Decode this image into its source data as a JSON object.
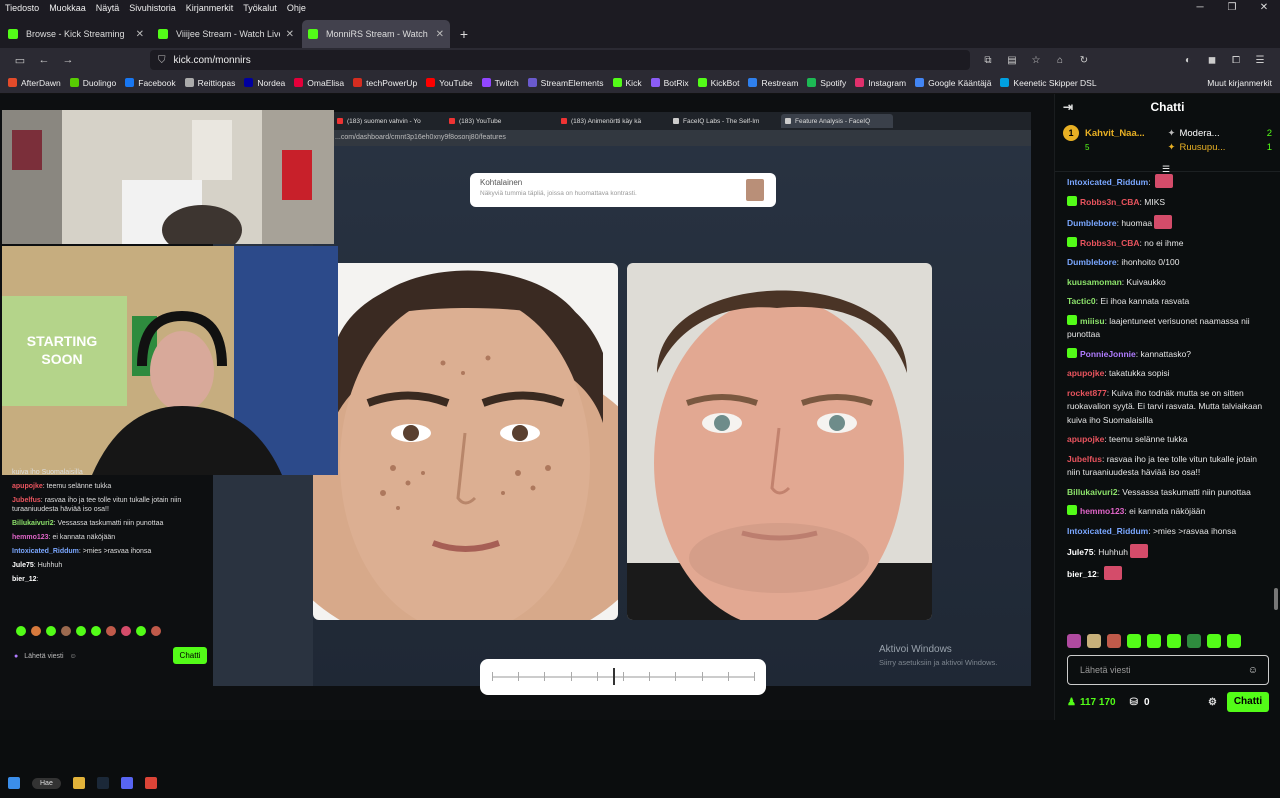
{
  "menu": [
    "Tiedosto",
    "Muokkaa",
    "Näytä",
    "Sivuhistoria",
    "Kirjanmerkit",
    "Työkalut",
    "Ohje"
  ],
  "tabs": [
    {
      "title": "Browse - Kick Streaming"
    },
    {
      "title": "Viiijee Stream - Watch Live"
    },
    {
      "title": "MonniRS Stream - Watch Li"
    }
  ],
  "url": "kick.com/monnirs",
  "bookmarks": [
    {
      "label": "AfterDawn",
      "color": "#e34b2a"
    },
    {
      "label": "Duolingo",
      "color": "#58cc02"
    },
    {
      "label": "Facebook",
      "color": "#1877f2"
    },
    {
      "label": "Reittiopas",
      "color": "#aaaaaa"
    },
    {
      "label": "Nordea",
      "color": "#0000a0"
    },
    {
      "label": "OmaElisa",
      "color": "#e4003a"
    },
    {
      "label": "techPowerUp",
      "color": "#d62d20"
    },
    {
      "label": "YouTube",
      "color": "#ff0000"
    },
    {
      "label": "Twitch",
      "color": "#9146ff"
    },
    {
      "label": "StreamElements",
      "color": "#6a5acd"
    },
    {
      "label": "Kick",
      "color": "#53fc18"
    },
    {
      "label": "BotRix",
      "color": "#8b5cf6"
    },
    {
      "label": "KickBot",
      "color": "#53fc18"
    },
    {
      "label": "Restream",
      "color": "#2f80ed"
    },
    {
      "label": "Spotify",
      "color": "#1db954"
    },
    {
      "label": "Instagram",
      "color": "#e1306c"
    },
    {
      "label": "Google Kääntäjä",
      "color": "#4285f4"
    },
    {
      "label": "Keenetic Skipper DSL",
      "color": "#00a0e0"
    }
  ],
  "bookmarks_other": "Muut kirjanmerkit",
  "stream": {
    "inner_tabs": [
      "(183) suomen vahvin - Yo",
      "(183) YouTube",
      "(183) Animenörtti käy kä",
      "FaceIQ Labs - The Self-Im",
      "Feature Analysis - FaceIQ"
    ],
    "inner_url": "...com/dashboard/cmnt3p16eh0xny9f8osonj80/features",
    "card_title": "Kohtalainen",
    "card_sub": "Näkyviä tummia täpliä, joissa on huomattava kontrasti.",
    "slider_value": 0.46,
    "watermark_title": "Aktivoi Windows",
    "watermark_sub": "Siirry asetuksiin ja aktivoi Windows.",
    "overlay_chat": [
      {
        "user": "",
        "text": "kuiva iho Suomalaisilla",
        "color": "#dddddd"
      },
      {
        "user": "apupojke",
        "text": "teemu selänne tukka",
        "color": "#e9545e"
      },
      {
        "user": "Jubelfus",
        "text": "rasvaa iho ja tee tolle vitun tukalle jotain niin turaaniuudesta häviää iso osa!!",
        "color": "#e9545e"
      },
      {
        "user": "Billukaivuri2",
        "text": "Vessassa taskumatti niin punottaa",
        "color": "#8de36b"
      },
      {
        "user": "hemmo123",
        "text": "ei kannata näköjään",
        "color": "#e065c8"
      },
      {
        "user": "Intoxicated_Riddum",
        "text": ">mies >rasvaa ihonsa",
        "color": "#7aa7ff"
      },
      {
        "user": "Jule75",
        "text": "Huhhuh",
        "color": "#ffffff"
      },
      {
        "user": "bier_12",
        "text": "",
        "color": "#ffffff"
      }
    ],
    "overlay_input": "Lähetä viesti",
    "overlay_chat_btn": "Chatti",
    "taskbar_search": "Hae"
  },
  "chat": {
    "title": "Chatti",
    "pinned": [
      {
        "name": "Kahvit_Naa...",
        "count": "5"
      },
      {
        "name": "Modera...",
        "count": "2"
      },
      {
        "name": "Ruusupu...",
        "count": "1"
      }
    ],
    "messages": [
      {
        "user": "Intoxicated_Riddum",
        "text": "",
        "color": "#7aa7ff"
      },
      {
        "user": "Robbs3n_CBA",
        "text": "MIKS",
        "color": "#e9545e"
      },
      {
        "user": "Dumblebore",
        "text": "huomaa",
        "color": "#7aa7ff"
      },
      {
        "user": "Robbs3n_CBA",
        "text": "no ei ihme",
        "color": "#e9545e"
      },
      {
        "user": "Dumblebore",
        "text": "ihonhoito 0/100",
        "color": "#7aa7ff"
      },
      {
        "user": "kuusamoman",
        "text": "Kuivaukko",
        "color": "#8de36b"
      },
      {
        "user": "Tactic0",
        "text": "Ei ihoa kannata rasvata",
        "color": "#8de36b"
      },
      {
        "user": "miiisu",
        "text": "laajentuneet verisuonet naamassa nii punottaa",
        "color": "#8de36b"
      },
      {
        "user": "PonnieJonnie",
        "text": "kannattasko?",
        "color": "#b07cff"
      },
      {
        "user": "apupojke",
        "text": "takatukka sopisi",
        "color": "#e9545e"
      },
      {
        "user": "rocket877",
        "text": "Kuiva iho todnäk mutta se on sitten ruokavalion syytä. Ei tarvi rasvata. Mutta talviaikaan kuiva iho Suomalaisilla",
        "color": "#e9545e"
      },
      {
        "user": "apupojke",
        "text": "teemu selänne tukka",
        "color": "#e9545e"
      },
      {
        "user": "Jubelfus",
        "text": "rasvaa iho ja tee tolle vitun tukalle jotain niin turaaniuudesta häviää iso osa!!",
        "color": "#e9545e"
      },
      {
        "user": "Billukaivuri2",
        "text": "Vessassa taskumatti niin punottaa",
        "color": "#8de36b"
      },
      {
        "user": "hemmo123",
        "text": "ei kannata näköjään",
        "color": "#e065c8"
      },
      {
        "user": "Intoxicated_Riddum",
        "text": ">mies >rasvaa ihonsa",
        "color": "#7aa7ff"
      },
      {
        "user": "Jule75",
        "text": "Huhhuh",
        "color": "#ffffff"
      },
      {
        "user": "bier_12",
        "text": "",
        "color": "#ffffff"
      }
    ],
    "input_placeholder": "Lähetä viesti",
    "viewers": "117 170",
    "points": "0",
    "send_label": "Chatti"
  }
}
